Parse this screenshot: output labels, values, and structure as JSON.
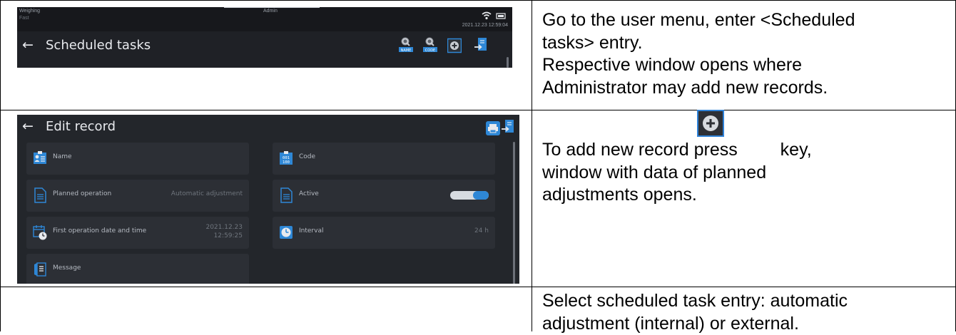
{
  "screen1": {
    "status_left_1": "Weighing",
    "status_left_2": "Fast",
    "status_user": "Admin",
    "status_datetime": "2021.12.23 12:59:04",
    "title": "Scheduled tasks",
    "back_glyph": "←",
    "icons": [
      "search-name-icon",
      "search-code-icon",
      "add-record-icon",
      "exit-icon"
    ],
    "search_name_label": "NAME",
    "search_code_label": "CODE"
  },
  "screen2": {
    "title": "Edit record",
    "back_glyph": "←",
    "header_icons": [
      "print-icon",
      "exit-icon"
    ],
    "fields": {
      "name": {
        "label": "Name",
        "value": "",
        "icon": "name-card-icon"
      },
      "code": {
        "label": "Code",
        "value": "",
        "icon": "code-icon",
        "icon_text_top": "001",
        "icon_text_bottom": "100"
      },
      "planned_operation": {
        "label": "Planned operation",
        "value": "Automatic adjustment",
        "icon": "document-icon"
      },
      "active": {
        "label": "Active",
        "value_on": true,
        "icon": "document-icon"
      },
      "first_operation": {
        "label": "First operation date and time",
        "value_date": "2021.12.23",
        "value_time": "12:59:25",
        "icon": "calendar-clock-icon"
      },
      "interval": {
        "label": "Interval",
        "value": "24 h",
        "icon": "clock-icon"
      },
      "message": {
        "label": "Message",
        "value": "",
        "icon": "message-icon"
      }
    }
  },
  "instructions": {
    "row1": [
      "Go to the user menu, enter <Scheduled",
      "tasks> entry.",
      "Respective window opens where",
      "Administrator may add new records."
    ],
    "row2_prefix": "To add new record press",
    "row2_suffix": "key,",
    "row2_lines": [
      "window with data of planned",
      "adjustments opens."
    ],
    "row3": [
      "Select scheduled task entry: automatic",
      "adjustment (internal) or external."
    ]
  },
  "colors": {
    "screen_bg": "#23262b",
    "field_bg": "#2c2f35",
    "accent": "#2e87d6",
    "text_light": "#e8eaee"
  }
}
